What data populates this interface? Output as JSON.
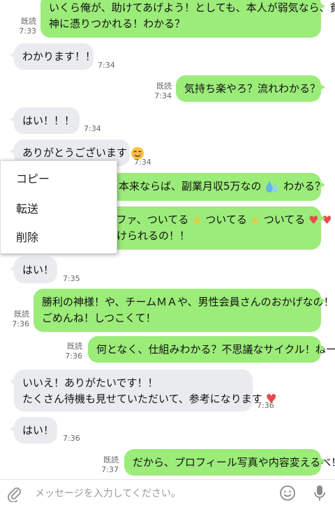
{
  "colors": {
    "outgoing_bubble": "#9cec7a",
    "incoming_bubble": "#e9ebef",
    "heart": "#e74c4c",
    "star": "#f2c531",
    "drop": "#64b5e8"
  },
  "messages": [
    {
      "dir": "out",
      "lines": [
        "いくら俺が、助けてあげよう！としても、本人が弱気なら、貧乏",
        "神に憑りつかれる！わかる？"
      ],
      "read": "既読",
      "time": "7:33"
    },
    {
      "dir": "in",
      "lines": [
        "わかります！！"
      ],
      "time": "7:34"
    },
    {
      "dir": "out",
      "lines": [
        "気持ち楽やろ？流れわかる？"
      ],
      "read": "既読",
      "time": "7:34"
    },
    {
      "dir": "in",
      "lines": [
        "はい！！！"
      ],
      "time": "7:34"
    },
    {
      "dir": "in",
      "lines": [
        "ありがとうございます"
      ],
      "emoji": "smile-emoji",
      "time": "7:34"
    },
    {
      "dir": "out",
      "lines": [
        "本来ならば、副業月収5万なの",
        "わかる？"
      ],
      "emoji": "drop-emoji"
    },
    {
      "dir": "out",
      "lines": [
        "ンファ、ついてる",
        "ついてる",
        "ついてる",
        "続けられるの！！"
      ],
      "emoji": "star-emoji"
    },
    {
      "dir": "in",
      "lines": [
        "はい！"
      ],
      "time": "7:35"
    },
    {
      "dir": "out",
      "lines": [
        "勝利の神様！や、チームＭＡや、男性会員さんのおかげなの！",
        "ごめんね！しつこくて！"
      ],
      "read": "既読",
      "time": "7:36"
    },
    {
      "dir": "out",
      "lines": [
        "何となく、仕組みわかる？不思議なサイクル！ねー"
      ],
      "read": "既読",
      "time": "7:36"
    },
    {
      "dir": "in",
      "lines": [
        "いいえ！ありがたいです！！",
        "たくさん待機も見せていただいて、参考になります"
      ],
      "emoji": "heart-emoji",
      "time": "7:36"
    },
    {
      "dir": "in",
      "lines": [
        "はい！"
      ],
      "time": "7:36"
    },
    {
      "dir": "out",
      "lines": [
        "だから、プロフィール写真や内容変えるべ！"
      ],
      "read": "既読",
      "time": "7:37"
    }
  ],
  "context_menu": {
    "copy": "コピー",
    "forward": "転送",
    "delete": "削除"
  },
  "input": {
    "placeholder": "メッセージを入力してください。",
    "attach_icon": "paperclip-icon",
    "emoji_icon": "smiley-icon",
    "mic_icon": "microphone-icon"
  }
}
